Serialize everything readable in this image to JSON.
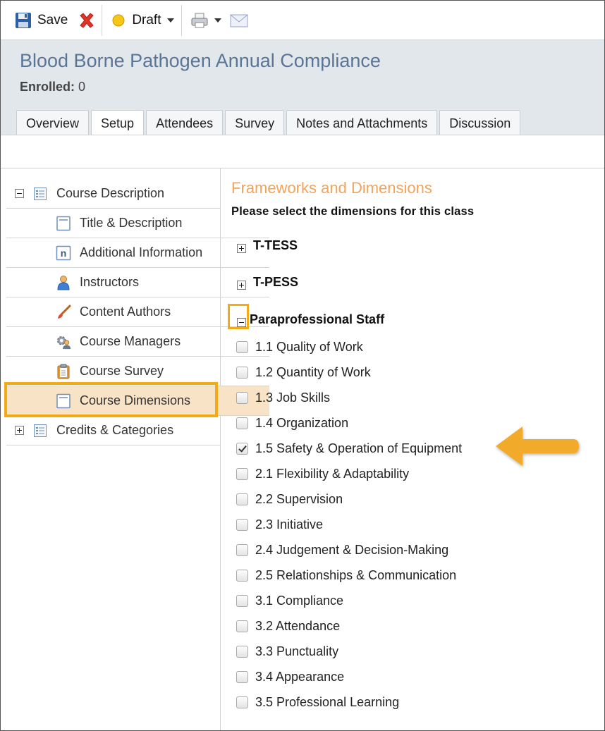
{
  "toolbar": {
    "save_label": "Save",
    "status_label": "Draft"
  },
  "header": {
    "course_title": "Blood Borne Pathogen Annual Compliance",
    "enrolled_label": "Enrolled:",
    "enrolled_value": "0"
  },
  "tabs": [
    {
      "label": "Overview"
    },
    {
      "label": "Setup"
    },
    {
      "label": "Attendees"
    },
    {
      "label": "Survey"
    },
    {
      "label": "Notes and Attachments"
    },
    {
      "label": "Discussion"
    }
  ],
  "active_tab": "Setup",
  "sidebar": {
    "items": [
      {
        "label": "Course Description",
        "icon": "document-list-icon",
        "expanded": true
      },
      {
        "label": "Title & Description",
        "icon": "page-icon"
      },
      {
        "label": "Additional Information",
        "icon": "info-n-icon"
      },
      {
        "label": "Instructors",
        "icon": "person-icon"
      },
      {
        "label": "Content Authors",
        "icon": "paintbrush-icon"
      },
      {
        "label": "Course Managers",
        "icon": "gear-person-icon"
      },
      {
        "label": "Course Survey",
        "icon": "clipboard-icon"
      },
      {
        "label": "Course Dimensions",
        "icon": "page-icon",
        "active": true
      },
      {
        "label": "Credits & Categories",
        "icon": "document-list-icon",
        "expanded": false
      }
    ]
  },
  "main": {
    "section_title": "Frameworks and Dimensions",
    "section_subtitle": "Please select the dimensions for this class",
    "frameworks": [
      {
        "label": "T-TESS",
        "expanded": false
      },
      {
        "label": "T-PESS",
        "expanded": false
      },
      {
        "label": "Paraprofessional Staff",
        "expanded": true
      }
    ],
    "dimensions": [
      {
        "label": "1.1 Quality of Work",
        "checked": false
      },
      {
        "label": "1.2 Quantity of Work",
        "checked": false
      },
      {
        "label": "1.3 Job Skills",
        "checked": false
      },
      {
        "label": "1.4 Organization",
        "checked": false
      },
      {
        "label": "1.5 Safety & Operation of Equipment",
        "checked": true
      },
      {
        "label": "2.1 Flexibility & Adaptability",
        "checked": false
      },
      {
        "label": "2.2 Supervision",
        "checked": false
      },
      {
        "label": "2.3 Initiative",
        "checked": false
      },
      {
        "label": "2.4 Judgement & Decision-Making",
        "checked": false
      },
      {
        "label": "2.5 Relationships & Communication",
        "checked": false
      },
      {
        "label": "3.1 Compliance",
        "checked": false
      },
      {
        "label": "3.2 Attendance",
        "checked": false
      },
      {
        "label": "3.3 Punctuality",
        "checked": false
      },
      {
        "label": "3.4 Appearance",
        "checked": false
      },
      {
        "label": "3.5 Professional Learning",
        "checked": false
      }
    ]
  },
  "colors": {
    "title_blue": "#5a7596",
    "section_orange": "#f3a35a",
    "highlight_orange": "#f2aa17",
    "active_row": "#f9e3c6",
    "header_bg": "#e2e7ec"
  }
}
